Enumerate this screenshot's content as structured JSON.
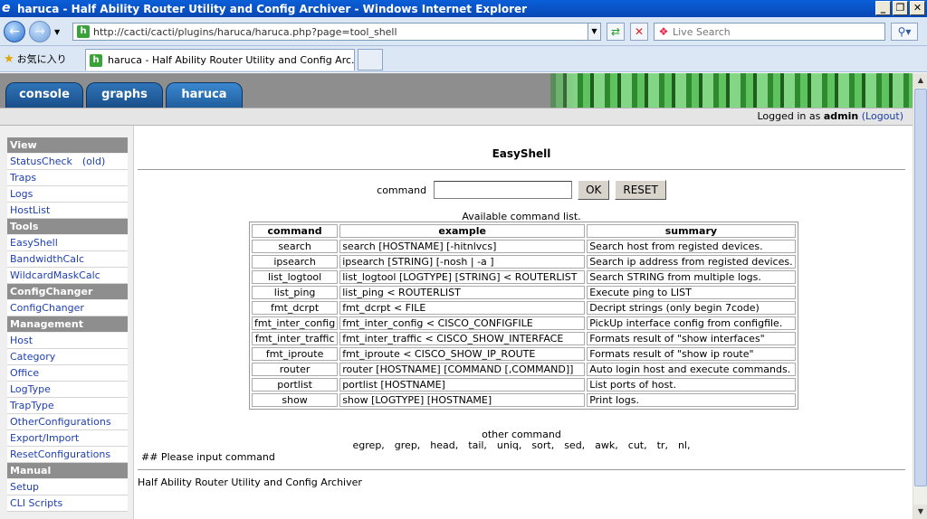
{
  "window": {
    "title": "haruca - Half Ability Router Utility and Config Archiver - Windows Internet Explorer",
    "minimize": "_",
    "maximize": "❐",
    "close": "✕"
  },
  "browser": {
    "url": "http://cacti/cacti/plugins/haruca/haruca.php?page=tool_shell",
    "search_placeholder": "Live Search",
    "favorites_label": "お気に入り",
    "tab_title": "haruca - Half Ability Router Utility and Config Arc..."
  },
  "header": {
    "tabs": [
      {
        "label": "console"
      },
      {
        "label": "graphs"
      },
      {
        "label": "haruca"
      }
    ],
    "login_prefix": "Logged in as",
    "user": "admin",
    "logout": "(Logout)"
  },
  "sidebar": {
    "view_head": "View",
    "view_items": [
      "StatusCheck　(old)",
      "Traps",
      "Logs",
      "HostList"
    ],
    "tools_head": "Tools",
    "tools_items": [
      "EasyShell",
      "BandwidthCalc",
      "WildcardMaskCalc"
    ],
    "config_head": "ConfigChanger",
    "config_items": [
      "ConfigChanger"
    ],
    "mgmt_head": "Management",
    "mgmt_items": [
      "Host",
      "Category",
      "Office",
      "LogType",
      "TrapType",
      "OtherConfigurations",
      "Export/Import",
      "ResetConfigurations"
    ],
    "manual_head": "Manual",
    "manual_items": [
      "Setup",
      "CLI Scripts"
    ]
  },
  "main": {
    "title": "EasyShell",
    "command_label": "command",
    "command_value": "",
    "ok_label": "OK",
    "reset_label": "RESET",
    "available_label": "Available command list.",
    "columns": [
      "command",
      "example",
      "summary"
    ],
    "rows": [
      [
        "search",
        "search [HOSTNAME] [-hitnlvcs]",
        "Search host from registed devices."
      ],
      [
        "ipsearch",
        "ipsearch [STRING] [-nosh | -a ]",
        "Search ip address from registed devices."
      ],
      [
        "list_logtool",
        "list_logtool [LOGTYPE] [STRING] < ROUTERLIST",
        "Search STRING from multiple logs."
      ],
      [
        "list_ping",
        "list_ping < ROUTERLIST",
        "Execute ping to LIST"
      ],
      [
        "fmt_dcrpt",
        "fmt_dcrpt < FILE",
        "Decript strings (only begin 7code)"
      ],
      [
        "fmt_inter_config",
        "fmt_inter_config < CISCO_CONFIGFILE",
        "PickUp interface config from configfile."
      ],
      [
        "fmt_inter_traffic",
        "fmt_inter_traffic < CISCO_SHOW_INTERFACE",
        "Formats result of \"show interfaces\""
      ],
      [
        "fmt_iproute",
        "fmt_iproute < CISCO_SHOW_IP_ROUTE",
        "Formats result of \"show ip route\""
      ],
      [
        "router",
        "router [HOSTNAME] [COMMAND [,COMMAND]]",
        "Auto login host and execute commands."
      ],
      [
        "portlist",
        "portlist [HOSTNAME]",
        "List ports of host."
      ],
      [
        "show",
        "show [LOGTYPE] [HOSTNAME]",
        "Print logs."
      ]
    ],
    "other_label": "other command",
    "other_commands": "egrep,　grep,　head,　tail,　uniq,　sort,　sed,　awk,　cut,　tr,　nl,",
    "prompt": "## Please input command",
    "footer": "Half Ability Router Utility and Config Archiver"
  }
}
